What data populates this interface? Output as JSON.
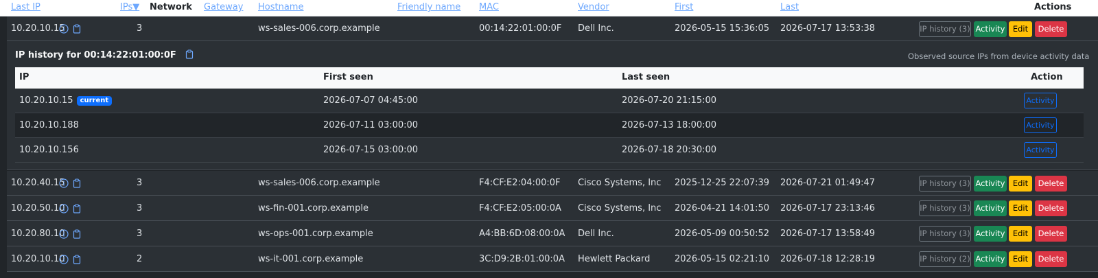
{
  "columns": {
    "last_ip": "Last IP",
    "ips": "IPs▼",
    "network": "Network",
    "gateway": "Gateway",
    "hostname": "Hostname",
    "friendly_name": "Friendly name",
    "mac": "MAC",
    "vendor": "Vendor",
    "first": "First",
    "last": "Last",
    "actions": "Actions"
  },
  "buttons": {
    "activity": "Activity",
    "edit": "Edit",
    "delete": "Delete"
  },
  "devices": [
    {
      "ip": "10.20.10.15",
      "ips": "3",
      "hostname": "ws-sales-006.corp.example",
      "mac": "00:14:22:01:00:0F",
      "vendor": "Dell Inc.",
      "first": "2026-05-15 15:36:05",
      "last": "2026-07-17 13:53:38",
      "history_label": "IP history (3)"
    },
    {
      "ip": "10.20.40.15",
      "ips": "3",
      "hostname": "ws-sales-006.corp.example",
      "mac": "F4:CF:E2:04:00:0F",
      "vendor": "Cisco Systems, Inc",
      "first": "2025-12-25 22:07:39",
      "last": "2026-07-21 01:49:47",
      "history_label": "IP history (3)"
    },
    {
      "ip": "10.20.50.10",
      "ips": "3",
      "hostname": "ws-fin-001.corp.example",
      "mac": "F4:CF:E2:05:00:0A",
      "vendor": "Cisco Systems, Inc",
      "first": "2026-04-21 14:01:50",
      "last": "2026-07-17 23:13:46",
      "history_label": "IP history (3)"
    },
    {
      "ip": "10.20.80.10",
      "ips": "3",
      "hostname": "ws-ops-001.corp.example",
      "mac": "A4:BB:6D:08:00:0A",
      "vendor": "Dell Inc.",
      "first": "2026-05-09 00:50:52",
      "last": "2026-07-17 13:58:49",
      "history_label": "IP history (3)"
    },
    {
      "ip": "10.20.10.10",
      "ips": "2",
      "hostname": "ws-it-001.corp.example",
      "mac": "3C:D9:2B:01:00:0A",
      "vendor": "Hewlett Packard",
      "first": "2026-05-15 02:21:10",
      "last": "2026-07-18 12:28:19",
      "history_label": "IP history (2)"
    }
  ],
  "history": {
    "title": "IP history for 00:14:22:01:00:0F",
    "note": "Observed source IPs from device activity data",
    "columns": {
      "ip": "IP",
      "first_seen": "First seen",
      "last_seen": "Last seen",
      "action": "Action"
    },
    "current_badge": "current",
    "action_label": "Activity",
    "rows": [
      {
        "ip": "10.20.10.15",
        "first_seen": "2026-07-07 04:45:00",
        "last_seen": "2026-07-20 21:15:00"
      },
      {
        "ip": "10.20.10.188",
        "first_seen": "2026-07-11 03:00:00",
        "last_seen": "2026-07-13 18:00:00"
      },
      {
        "ip": "10.20.10.156",
        "first_seen": "2026-07-15 03:00:00",
        "last_seen": "2026-07-18 20:30:00"
      }
    ]
  },
  "colors": {
    "background": "#212529",
    "row": "#2b3035",
    "link": "#6ea8fe",
    "success": "#198754",
    "warning": "#ffc107",
    "danger": "#dc3545",
    "primary": "#0d6efd"
  }
}
